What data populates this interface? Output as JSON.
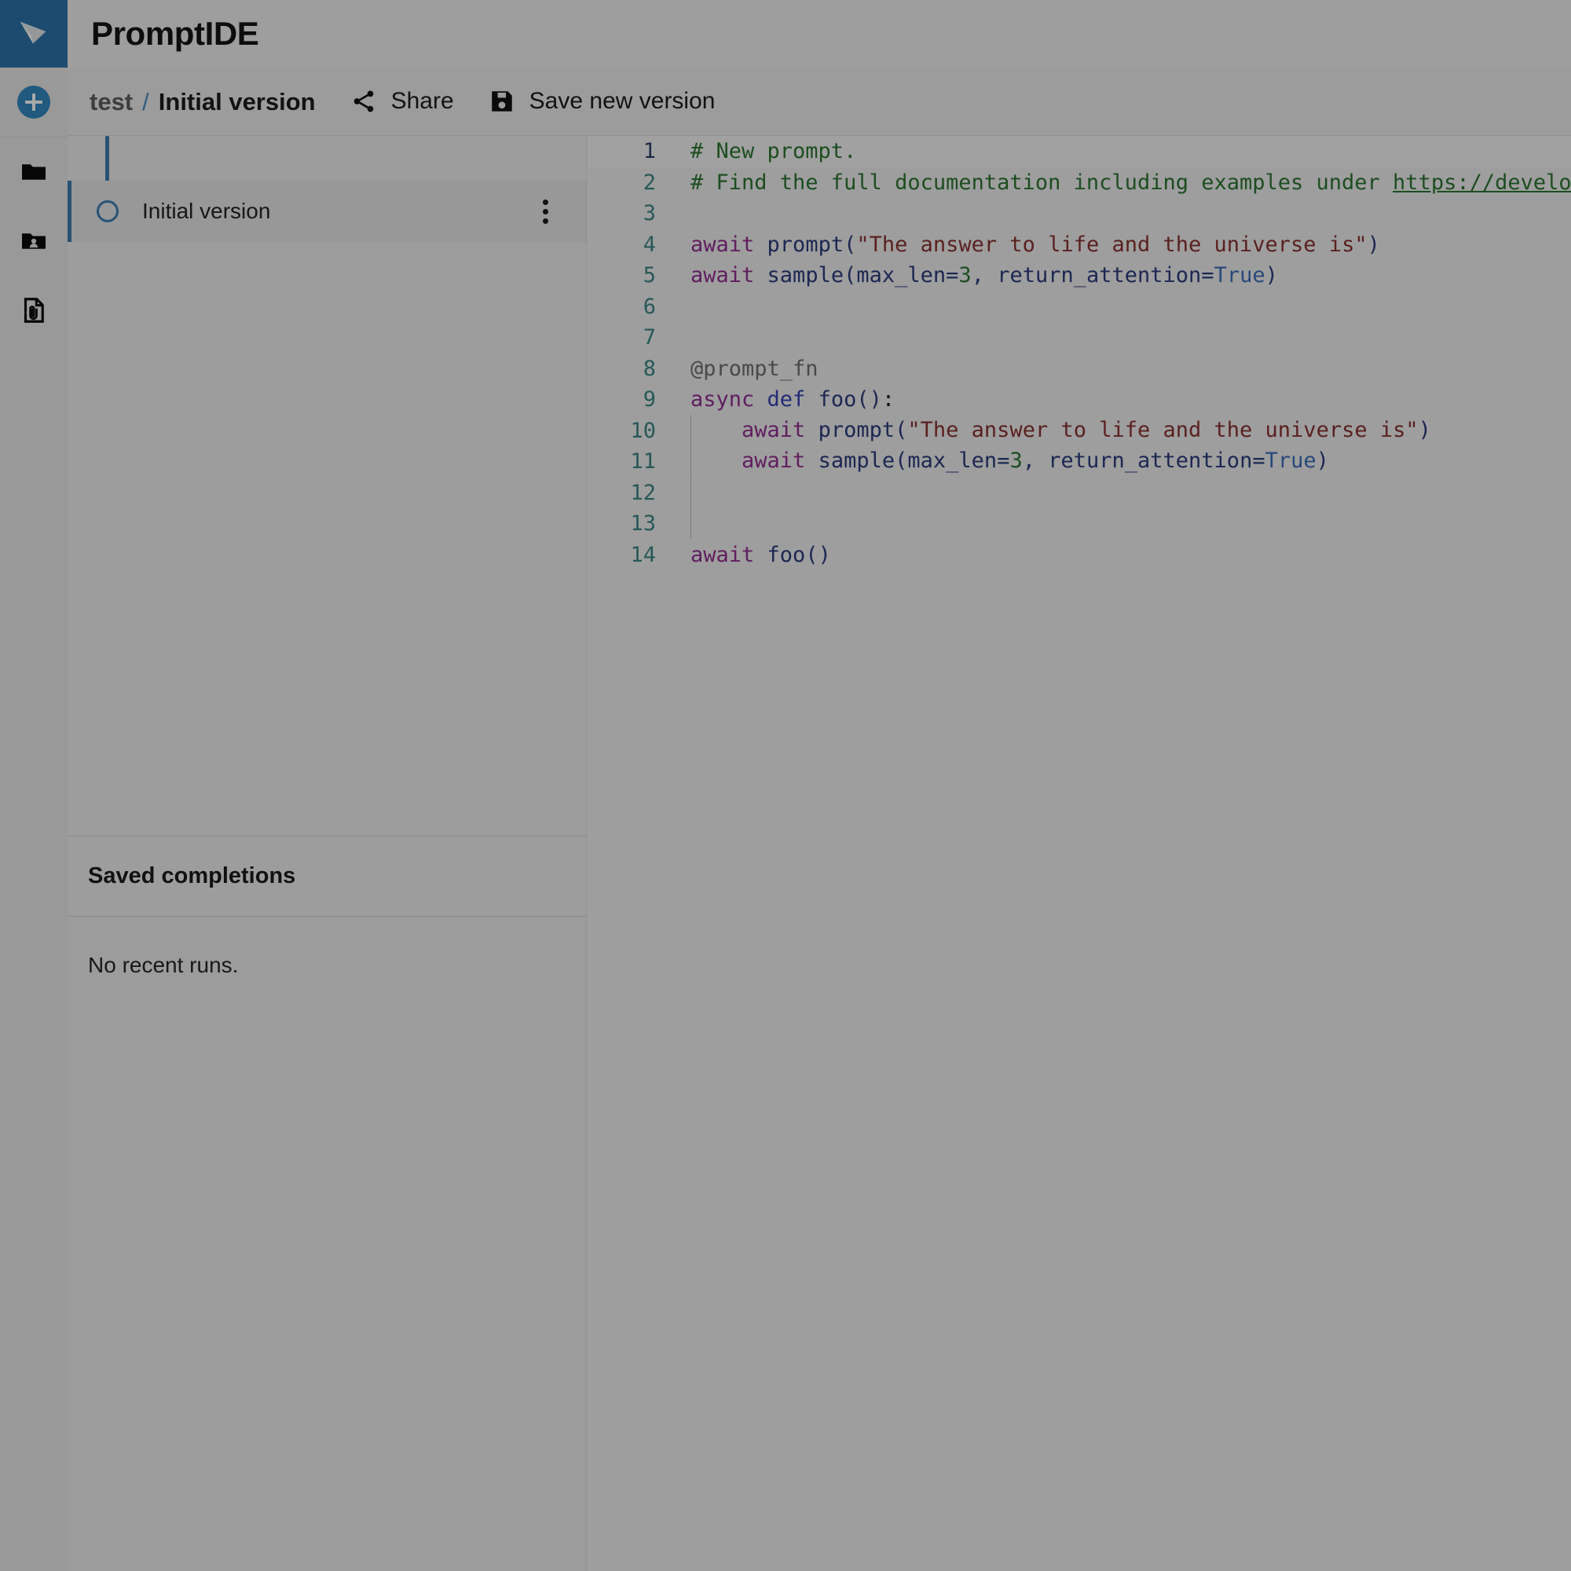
{
  "app": {
    "title": "PromptIDE",
    "logo_icon": "paper-plane-logo-icon"
  },
  "rail": {
    "items": [
      {
        "name": "new-prompt",
        "icon": "plus-circle-icon",
        "label": "New"
      },
      {
        "name": "files",
        "icon": "folder-icon",
        "label": "Files"
      },
      {
        "name": "shared-files",
        "icon": "folder-shared-user-icon",
        "label": "Shared with me"
      },
      {
        "name": "attachments",
        "icon": "document-attachment-paperclip-icon",
        "label": "Attachments"
      }
    ]
  },
  "actionbar": {
    "project": "test",
    "separator": "/",
    "version": "Initial version",
    "share_label": "Share",
    "share_icon": "share-network-icon",
    "save_label": "Save new version",
    "save_icon": "floppy-disk-save-icon"
  },
  "versions": {
    "items": [
      {
        "label": "Initial version",
        "selected": true,
        "menu_icon": "kebab-vertical-menu-icon"
      }
    ]
  },
  "saved_completions": {
    "header": "Saved completions",
    "empty_text": "No recent runs."
  },
  "colors": {
    "brand_blue": "#1b75bb",
    "accent_blue": "#2d7fc1",
    "comment_green": "#1d7a23",
    "keyword_purple": "#a626a4",
    "string_red": "#9b2c2c",
    "linenum_teal": "#2b8a8a"
  },
  "editor": {
    "language": "python",
    "lines": [
      {
        "n": "1",
        "active": true,
        "indent": 0,
        "tokens": [
          {
            "c": "t-com",
            "t": "# New prompt."
          }
        ]
      },
      {
        "n": "2",
        "active": false,
        "indent": 0,
        "tokens": [
          {
            "c": "t-com",
            "t": "# Find the full documentation including examples under "
          },
          {
            "c": "t-link",
            "t": "https://develop"
          }
        ]
      },
      {
        "n": "3",
        "active": false,
        "indent": 0,
        "tokens": []
      },
      {
        "n": "4",
        "active": false,
        "indent": 0,
        "tokens": [
          {
            "c": "t-kw",
            "t": "await"
          },
          {
            "c": "",
            "t": " "
          },
          {
            "c": "t-fn",
            "t": "prompt"
          },
          {
            "c": "t-punc",
            "t": "("
          },
          {
            "c": "t-str",
            "t": "\"The answer to life and the universe is\""
          },
          {
            "c": "t-punc",
            "t": ")"
          }
        ]
      },
      {
        "n": "5",
        "active": false,
        "indent": 0,
        "tokens": [
          {
            "c": "t-kw",
            "t": "await"
          },
          {
            "c": "",
            "t": " "
          },
          {
            "c": "t-fn",
            "t": "sample"
          },
          {
            "c": "t-punc",
            "t": "("
          },
          {
            "c": "t-var",
            "t": "max_len"
          },
          {
            "c": "t-punc",
            "t": "="
          },
          {
            "c": "t-num",
            "t": "3"
          },
          {
            "c": "t-punc",
            "t": ", "
          },
          {
            "c": "t-var",
            "t": "return_attention"
          },
          {
            "c": "t-punc",
            "t": "="
          },
          {
            "c": "t-bool",
            "t": "True"
          },
          {
            "c": "t-punc",
            "t": ")"
          }
        ]
      },
      {
        "n": "6",
        "active": false,
        "indent": 0,
        "tokens": []
      },
      {
        "n": "7",
        "active": false,
        "indent": 0,
        "tokens": []
      },
      {
        "n": "8",
        "active": false,
        "indent": 0,
        "tokens": [
          {
            "c": "t-dec",
            "t": "@prompt_fn"
          }
        ]
      },
      {
        "n": "9",
        "active": false,
        "indent": 0,
        "tokens": [
          {
            "c": "t-kw",
            "t": "async"
          },
          {
            "c": "",
            "t": " "
          },
          {
            "c": "t-kw2",
            "t": "def"
          },
          {
            "c": "",
            "t": " "
          },
          {
            "c": "t-fn",
            "t": "foo"
          },
          {
            "c": "t-punc",
            "t": "()"
          },
          {
            "c": "",
            "t": ":"
          }
        ]
      },
      {
        "n": "10",
        "active": false,
        "indent": 1,
        "tokens": [
          {
            "c": "t-kw",
            "t": "await"
          },
          {
            "c": "",
            "t": " "
          },
          {
            "c": "t-fn",
            "t": "prompt"
          },
          {
            "c": "t-punc",
            "t": "("
          },
          {
            "c": "t-str",
            "t": "\"The answer to life and the universe is\""
          },
          {
            "c": "t-punc",
            "t": ")"
          }
        ]
      },
      {
        "n": "11",
        "active": false,
        "indent": 1,
        "tokens": [
          {
            "c": "t-kw",
            "t": "await"
          },
          {
            "c": "",
            "t": " "
          },
          {
            "c": "t-fn",
            "t": "sample"
          },
          {
            "c": "t-punc",
            "t": "("
          },
          {
            "c": "t-var",
            "t": "max_len"
          },
          {
            "c": "t-punc",
            "t": "="
          },
          {
            "c": "t-num",
            "t": "3"
          },
          {
            "c": "t-punc",
            "t": ", "
          },
          {
            "c": "t-var",
            "t": "return_attention"
          },
          {
            "c": "t-punc",
            "t": "="
          },
          {
            "c": "t-bool",
            "t": "True"
          },
          {
            "c": "t-punc",
            "t": ")"
          }
        ]
      },
      {
        "n": "12",
        "active": false,
        "indent": 1,
        "tokens": []
      },
      {
        "n": "13",
        "active": false,
        "indent": 1,
        "tokens": []
      },
      {
        "n": "14",
        "active": false,
        "indent": 0,
        "tokens": [
          {
            "c": "t-kw",
            "t": "await"
          },
          {
            "c": "",
            "t": " "
          },
          {
            "c": "t-fn",
            "t": "foo"
          },
          {
            "c": "t-punc",
            "t": "()"
          }
        ]
      }
    ]
  }
}
